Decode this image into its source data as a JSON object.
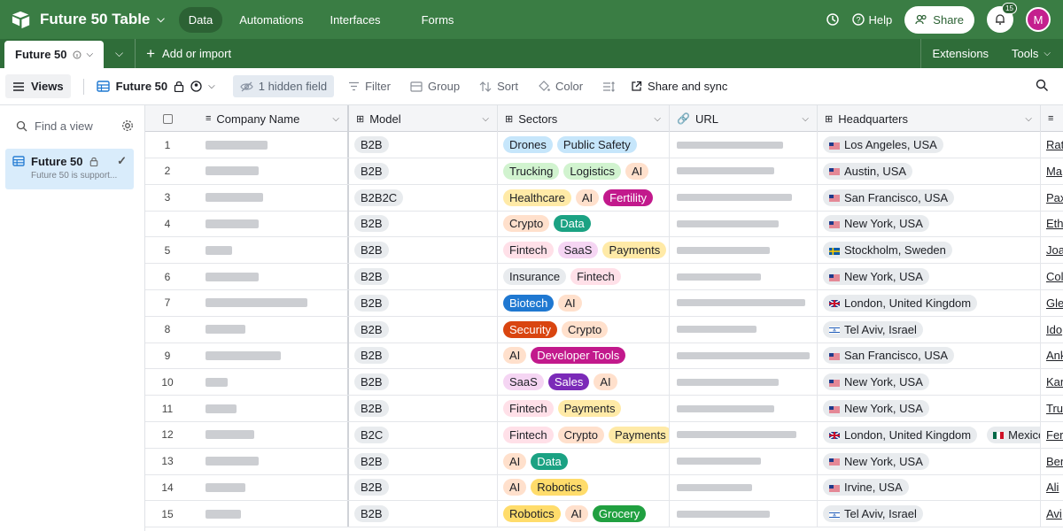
{
  "topbar": {
    "base_title": "Future 50 Table",
    "nav": [
      "Data",
      "Automations",
      "Interfaces",
      "Forms"
    ],
    "help": "Help",
    "share": "Share",
    "notifications": "15",
    "avatar": "M"
  },
  "tabbar": {
    "table_tab": "Future 50",
    "add_import": "Add or import",
    "extensions": "Extensions",
    "tools": "Tools"
  },
  "viewbar": {
    "views": "Views",
    "view_name": "Future 50",
    "hidden_field": "1 hidden field",
    "filter": "Filter",
    "group": "Group",
    "sort": "Sort",
    "color": "Color",
    "share_sync": "Share and sync"
  },
  "sidebar": {
    "find_placeholder": "Find a view",
    "view_item": "Future 50",
    "view_sub": "Future 50 is support..."
  },
  "columns": [
    "Company Name",
    "Model",
    "Sectors",
    "URL",
    "Headquarters"
  ],
  "rows": [
    {
      "n": "1",
      "model": "B2B",
      "sectors": [
        [
          "Drones",
          "#c6e6fb"
        ],
        [
          "Public Safety",
          "#c6e6fb"
        ]
      ],
      "hq": [
        [
          "us",
          "Los Angeles, USA"
        ]
      ],
      "extra": "Rat"
    },
    {
      "n": "2",
      "model": "B2B",
      "sectors": [
        [
          "Trucking",
          "#d1f3cf"
        ],
        [
          "Logistics",
          "#d1f3cf"
        ],
        [
          "AI",
          "#ffe0cc"
        ]
      ],
      "hq": [
        [
          "us",
          "Austin, USA"
        ]
      ],
      "extra": "Ma"
    },
    {
      "n": "3",
      "model": "B2B2C",
      "sectors": [
        [
          "Healthcare",
          "#ffeaa7"
        ],
        [
          "AI",
          "#ffe0cc"
        ],
        [
          "Fertility",
          "#c2198c"
        ]
      ],
      "hq": [
        [
          "us",
          "San Francisco, USA"
        ]
      ],
      "extra": "Pax"
    },
    {
      "n": "4",
      "model": "B2B",
      "sectors": [
        [
          "Crypto",
          "#ffe0cc"
        ],
        [
          "Data",
          "#1ba283"
        ]
      ],
      "hq": [
        [
          "us",
          "New York, USA"
        ]
      ],
      "extra": "Eth"
    },
    {
      "n": "5",
      "model": "B2B",
      "sectors": [
        [
          "Fintech",
          "#ffe0e8"
        ],
        [
          "SaaS",
          "#f5d5f3"
        ],
        [
          "Payments",
          "#ffeaa7"
        ]
      ],
      "hq": [
        [
          "se",
          "Stockholm, Sweden"
        ]
      ],
      "extra": "Joa"
    },
    {
      "n": "6",
      "model": "B2B",
      "sectors": [
        [
          "Insurance",
          "#e8ebee"
        ],
        [
          "Fintech",
          "#ffe0e8"
        ]
      ],
      "hq": [
        [
          "us",
          "New York, USA"
        ]
      ],
      "extra": "Col"
    },
    {
      "n": "7",
      "model": "B2B",
      "sectors": [
        [
          "Biotech",
          "#1f78d1"
        ],
        [
          "AI",
          "#ffe0cc"
        ]
      ],
      "hq": [
        [
          "gb",
          "London, United Kingdom"
        ]
      ],
      "extra": "Gle"
    },
    {
      "n": "8",
      "model": "B2B",
      "sectors": [
        [
          "Security",
          "#d94510"
        ],
        [
          "Crypto",
          "#ffe0cc"
        ]
      ],
      "hq": [
        [
          "il",
          "Tel Aviv, Israel"
        ]
      ],
      "extra": "Ido"
    },
    {
      "n": "9",
      "model": "B2B",
      "sectors": [
        [
          "AI",
          "#ffe0cc"
        ],
        [
          "Developer Tools",
          "#c2198c"
        ]
      ],
      "hq": [
        [
          "us",
          "San Francisco, USA"
        ]
      ],
      "extra": "Ank"
    },
    {
      "n": "10",
      "model": "B2B",
      "sectors": [
        [
          "SaaS",
          "#f5d5f3"
        ],
        [
          "Sales",
          "#7b2ab8"
        ],
        [
          "AI",
          "#ffe0cc"
        ]
      ],
      "hq": [
        [
          "us",
          "New York, USA"
        ]
      ],
      "extra": "Kar"
    },
    {
      "n": "11",
      "model": "B2B",
      "sectors": [
        [
          "Fintech",
          "#ffe0e8"
        ],
        [
          "Payments",
          "#ffeaa7"
        ]
      ],
      "hq": [
        [
          "us",
          "New York, USA"
        ]
      ],
      "extra": "Tru"
    },
    {
      "n": "12",
      "model": "B2C",
      "sectors": [
        [
          "Fintech",
          "#ffe0e8"
        ],
        [
          "Crypto",
          "#ffe0cc"
        ],
        [
          "Payments",
          "#ffeaa7"
        ]
      ],
      "hq": [
        [
          "gb",
          "London, United Kingdom"
        ],
        [
          "mx",
          "Mexico C"
        ]
      ],
      "extra": "Fer"
    },
    {
      "n": "13",
      "model": "B2B",
      "sectors": [
        [
          "AI",
          "#ffe0cc"
        ],
        [
          "Data",
          "#1ba283"
        ]
      ],
      "hq": [
        [
          "us",
          "New York, USA"
        ]
      ],
      "extra": "Ben"
    },
    {
      "n": "14",
      "model": "B2B",
      "sectors": [
        [
          "AI",
          "#ffe0cc"
        ],
        [
          "Robotics",
          "#ffdc6b"
        ]
      ],
      "hq": [
        [
          "us",
          "Irvine, USA"
        ]
      ],
      "extra": "Ali"
    },
    {
      "n": "15",
      "model": "B2B",
      "sectors": [
        [
          "Robotics",
          "#ffdc6b"
        ],
        [
          "AI",
          "#ffe0cc"
        ],
        [
          "Grocery",
          "#20a040"
        ]
      ],
      "hq": [
        [
          "il",
          "Tel Aviv, Israel"
        ]
      ],
      "extra": "Avi"
    }
  ],
  "colors": {
    "topbar": "#3a7d44",
    "tabbar": "#2f6d39",
    "selected_view": "#d9ecfb"
  }
}
